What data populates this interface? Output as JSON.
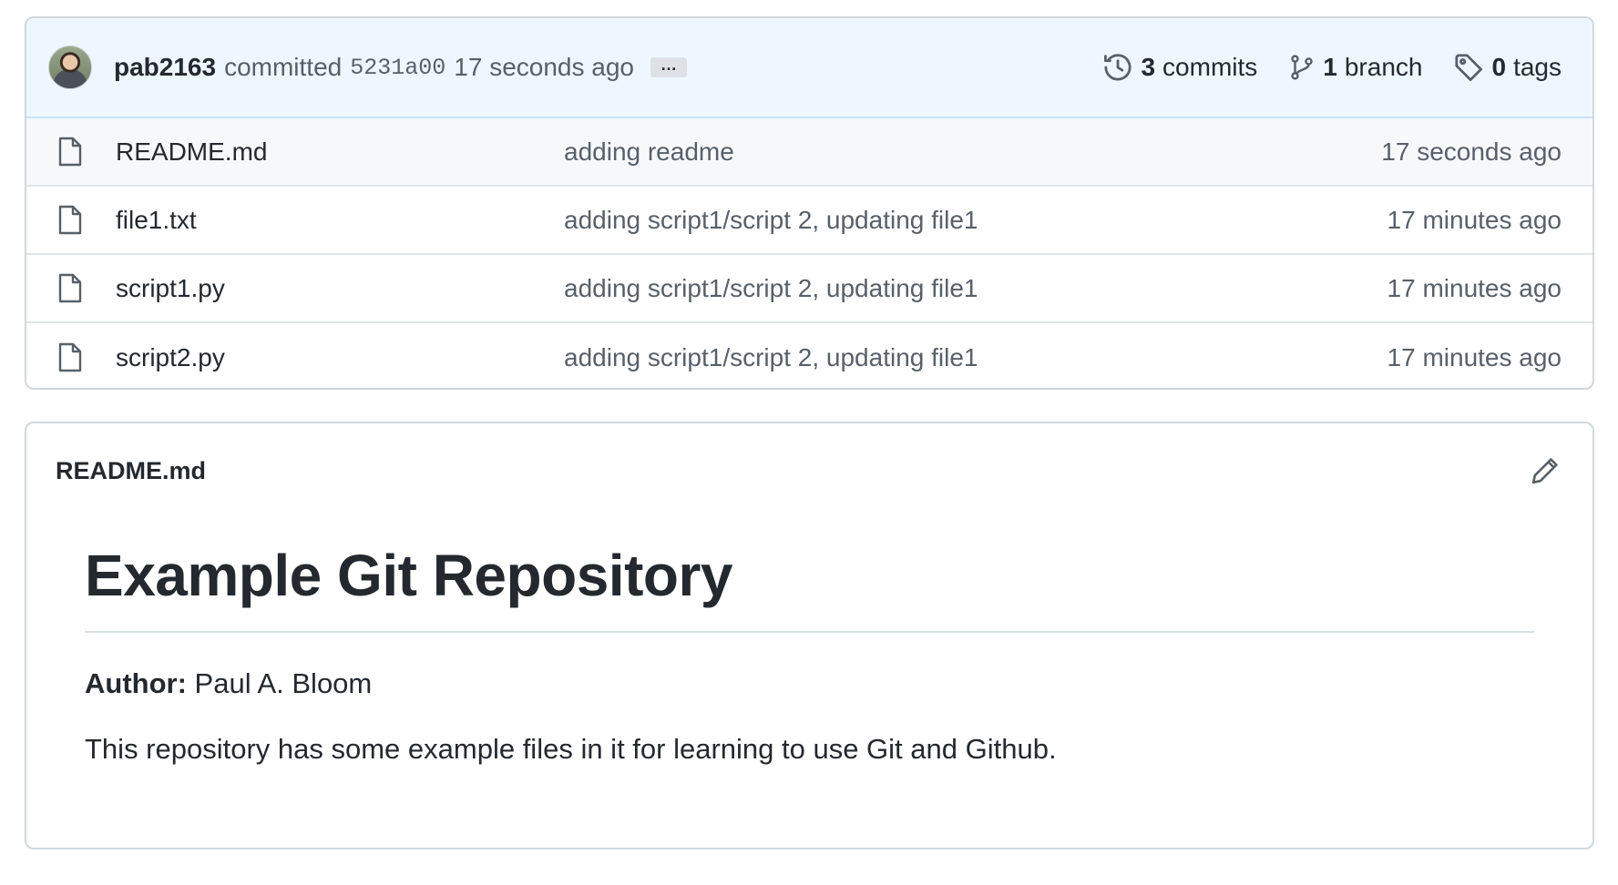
{
  "commit_bar": {
    "author": "pab2163",
    "action": "committed",
    "sha": "5231a00",
    "time": "17 seconds ago",
    "ellipsis": "…",
    "commits": {
      "count": "3",
      "label": "commits",
      "icon": "history-icon"
    },
    "branches": {
      "count": "1",
      "label": "branch",
      "icon": "git-branch-icon"
    },
    "tags": {
      "count": "0",
      "label": "tags",
      "icon": "tag-icon"
    }
  },
  "files": [
    {
      "name": "README.md",
      "message": "adding readme",
      "time": "17 seconds ago",
      "icon": "file-icon"
    },
    {
      "name": "file1.txt",
      "message": "adding script1/script 2, updating file1",
      "time": "17 minutes ago",
      "icon": "file-icon"
    },
    {
      "name": "script1.py",
      "message": "adding script1/script 2, updating file1",
      "time": "17 minutes ago",
      "icon": "file-icon"
    },
    {
      "name": "script2.py",
      "message": "adding script1/script 2, updating file1",
      "time": "17 minutes ago",
      "icon": "file-icon"
    }
  ],
  "readme": {
    "filename": "README.md",
    "edit_icon": "pencil-icon",
    "heading": "Example Git Repository",
    "author_label": "Author:",
    "author_name": "Paul A. Bloom",
    "description": "This repository has some example files in it for learning to use Git and Github."
  },
  "colors": {
    "commit_bar_bg": "#eef7ff",
    "border": "#d0d7de",
    "muted_text": "#57606a",
    "text": "#24292f"
  }
}
